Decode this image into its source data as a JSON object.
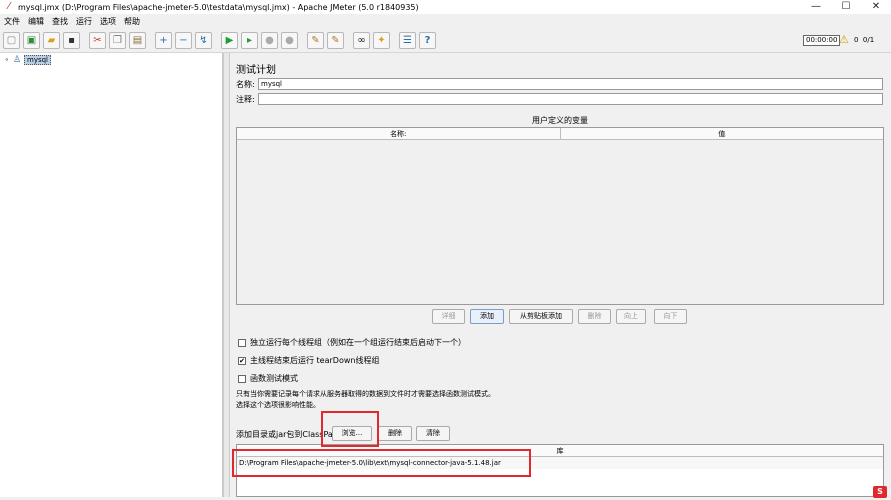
{
  "window": {
    "title": "mysql.jmx (D:\\Program Files\\apache-jmeter-5.0\\testdata\\mysql.jmx) - Apache JMeter (5.0 r1840935)",
    "controls": {
      "minimize": "—",
      "maximize": "☐",
      "close": "✕"
    }
  },
  "menu": {
    "items": [
      "文件",
      "编辑",
      "查找",
      "运行",
      "选项",
      "帮助"
    ]
  },
  "toolbar": {
    "icons": [
      "new-icon",
      "templates-icon",
      "open-icon",
      "save-icon",
      "cut-icon",
      "copy-icon",
      "paste-icon",
      "expand-icon",
      "collapse-icon",
      "toggle-icon",
      "start-icon",
      "start-no-pause-icon",
      "stop-icon",
      "shutdown-icon",
      "clear-icon",
      "clear-all-icon",
      "search-icon",
      "reset-search-icon",
      "function-helper-icon",
      "help-icon"
    ],
    "timer": "00:00:00",
    "error_count": "0",
    "thread_count": "0/1"
  },
  "tree": {
    "root_label": "mysql"
  },
  "test_plan": {
    "heading": "测试计划",
    "name_label": "名称:",
    "name_value": "mysql",
    "comment_label": "注释:",
    "comment_value": "",
    "user_vars_title": "用户定义的变量",
    "col_name": "名称:",
    "col_value": "值",
    "buttons": {
      "detail": "详细",
      "add": "添加",
      "add_from_clipboard": "从剪贴板添加",
      "delete": "删除",
      "up": "向上",
      "down": "向下"
    },
    "options": {
      "serialize_label": "独立运行每个线程组（例如在一个组运行结束后启动下一个）",
      "serialize_checked": false,
      "teardown_label": "主线程结束后运行 tearDown线程组",
      "teardown_checked": true,
      "functional_label": "函数测试模式",
      "functional_checked": false
    },
    "functional_note_line1": "只有当你需要记录每个请求从服务器取得的数据到文件时才需要选择函数测试模式。",
    "functional_note_line2": "选择这个选项很影响性能。",
    "classpath_label": "添加目录或jar包到ClassPath",
    "classpath_buttons": {
      "browse": "浏览...",
      "delete": "删除",
      "clear": "清除"
    },
    "lib_header": "库",
    "lib_entries": [
      "D:\\Program Files\\apache-jmeter-5.0\\lib\\ext\\mysql-connector-java-5.1.48.jar"
    ]
  },
  "corner_logo": "S"
}
